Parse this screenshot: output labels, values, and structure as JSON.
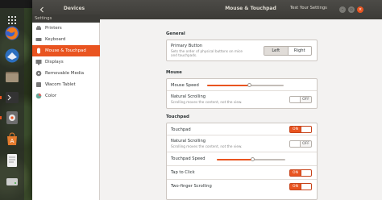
{
  "window": {
    "back_icon": "chevron-left-icon",
    "section_title": "Devices",
    "title": "Mouse & Touchpad",
    "test_settings_label": "Test Your Settings",
    "window_buttons": [
      "minimize-icon",
      "maximize-icon",
      "close-icon"
    ],
    "accent_color": "#e95420"
  },
  "settings_label": "Settings",
  "sidebar": {
    "items": [
      {
        "label": "Printers",
        "icon": "printer-icon",
        "selected": false
      },
      {
        "label": "Keyboard",
        "icon": "keyboard-icon",
        "selected": false
      },
      {
        "label": "Mouse & Touchpad",
        "icon": "mouse-icon",
        "selected": true
      },
      {
        "label": "Displays",
        "icon": "display-icon",
        "selected": false
      },
      {
        "label": "Removable Media",
        "icon": "removable-media-icon",
        "selected": false
      },
      {
        "label": "Wacom Tablet",
        "icon": "tablet-icon",
        "selected": false
      },
      {
        "label": "Color",
        "icon": "color-icon",
        "selected": false
      }
    ]
  },
  "general": {
    "heading": "General",
    "primary_button": {
      "label": "Primary Button",
      "description": "Sets the order of physical buttons on mice and touchpads.",
      "left_label": "Left",
      "right_label": "Right",
      "selected": "Left"
    }
  },
  "mouse": {
    "heading": "Mouse",
    "speed_label": "Mouse Speed",
    "speed_value": 0.55,
    "natural_scrolling": {
      "label": "Natural Scrolling",
      "description": "Scrolling moves the content, not the view.",
      "state_text": "OFF"
    }
  },
  "touchpad": {
    "heading": "Touchpad",
    "touchpad_toggle": {
      "label": "Touchpad",
      "state_text": "ON"
    },
    "natural_scrolling": {
      "label": "Natural Scrolling",
      "description": "Scrolling moves the content, not the view.",
      "state_text": "OFF"
    },
    "speed_label": "Touchpad Speed",
    "speed_value": 0.52,
    "tap_to_click": {
      "label": "Tap to Click",
      "state_text": "ON"
    },
    "two_finger": {
      "label": "Two-finger Scrolling",
      "state_text": "ON"
    }
  },
  "launcher": {
    "items": [
      "firefox-icon",
      "thunderbird-icon",
      "files-icon",
      "terminal-icon",
      "settings-icon",
      "software-center-icon",
      "text-editor-icon",
      "apps-grid-icon"
    ]
  }
}
